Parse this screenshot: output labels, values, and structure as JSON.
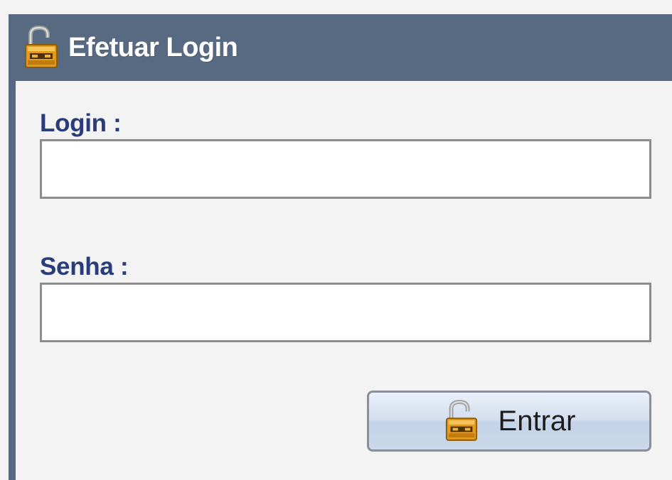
{
  "window": {
    "title": "Efetuar Login",
    "title_icon": "padlock-open-icon"
  },
  "form": {
    "login_label": "Login :",
    "login_value": "",
    "senha_label": "Senha :",
    "senha_value": "",
    "submit_label": "Entrar",
    "submit_icon": "padlock-open-icon"
  },
  "colors": {
    "titlebar": "#576a82",
    "label_text": "#2a3c7a",
    "background": "#f3f3f3"
  }
}
